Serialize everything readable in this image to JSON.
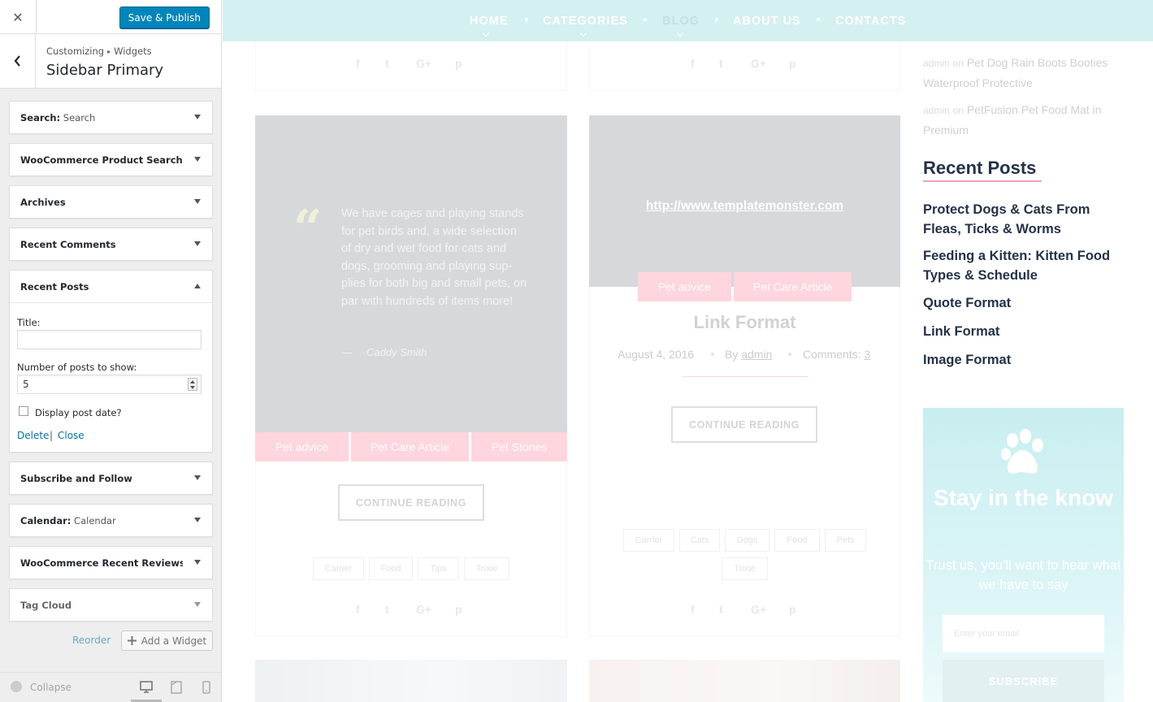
{
  "customizer": {
    "close_label": "✕",
    "save_label": "Save & Publish",
    "breadcrumb_root": "Customizing",
    "breadcrumb_sep": "▸",
    "breadcrumb_leaf": "Widgets",
    "section_title": "Sidebar Primary",
    "widgets": [
      {
        "name": "Search:",
        "sub": " Search"
      },
      {
        "name": "WooCommerce Product Search",
        "sub": ""
      },
      {
        "name": "Archives",
        "sub": ""
      },
      {
        "name": "Recent Comments",
        "sub": ""
      },
      {
        "name": "Recent Posts",
        "sub": ""
      },
      {
        "name": "Subscribe and Follow",
        "sub": ""
      },
      {
        "name": "Calendar:",
        "sub": " Calendar"
      },
      {
        "name": "WooCommerce Recent Reviews: ...",
        "sub": ""
      },
      {
        "name": "Tag Cloud",
        "sub": ""
      }
    ],
    "recent_posts_form": {
      "title_label": "Title:",
      "title_value": "",
      "number_label": "Number of posts to show:",
      "number_value": "5",
      "display_date_label": "Display post date?",
      "display_date_checked": false,
      "delete_label": "Delete",
      "separator": "|",
      "close_label": "Close"
    },
    "reorder_label": "Reorder",
    "add_widget_label": "Add a Widget",
    "collapse_label": "Collapse",
    "preview_device_selected": "desktop"
  },
  "site": {
    "nav": [
      "HOME",
      "CATEGORIES",
      "BLOG",
      "ABOUT US",
      "CONTACTS"
    ],
    "nav_active": "BLOG",
    "quote_post": {
      "text": "We have cages and playing stands for pet birds and, a wide selection of dry and wet food for cats and dogs, grooming and playing sup- plies for both big and small pets, on par with hundreds of items more!",
      "author_dash": "—",
      "author": "Caddy Smith",
      "categories": [
        "Pet advice",
        "Pet Care Article",
        "Pet Stories"
      ],
      "button": "CONTINUE READING",
      "tags": [
        "Carrier",
        "Food",
        "Tips",
        "Trixie"
      ]
    },
    "link_post": {
      "url": "http://www.templatemonster.com",
      "categories": [
        "Pet advice",
        "Pet Care Article"
      ],
      "title": "Link Format",
      "date": "August 4, 2016",
      "by_label": "By",
      "author": "admin",
      "comments_label": "Comments:",
      "comments_count": "3",
      "button": "CONTINUE READING",
      "tags": [
        "Carrier",
        "Cats",
        "Dogs",
        "Food",
        "Pets",
        "Trixie"
      ]
    },
    "sidebar": {
      "recent_comments": [
        {
          "author": "admin",
          "on": "on",
          "post": "Pet Dog Rain Boots Booties Waterproof Protective"
        },
        {
          "author": "admin",
          "on": "on",
          "post": "PetFusion Pet Food Mat in Premium"
        }
      ],
      "recent_posts_title": "Recent Posts",
      "recent_posts": [
        "Protect Dogs & Cats From Fleas, Ticks & Worms",
        "Feeding a Kitten: Kitten Food Types & Schedule",
        "Quote Format",
        "Link Format",
        "Image Format"
      ],
      "subscribe": {
        "title": "Stay in the know",
        "text": "Trust us, you'll want to hear what we have to say",
        "placeholder": "Enter your email",
        "button": "SUBSCRIBE"
      }
    },
    "colors": {
      "nav_bg": "#d4f0f1",
      "heading": "#23324a",
      "accent_pink": "#f2a3b4",
      "wp_blue": "#0085ba"
    }
  }
}
